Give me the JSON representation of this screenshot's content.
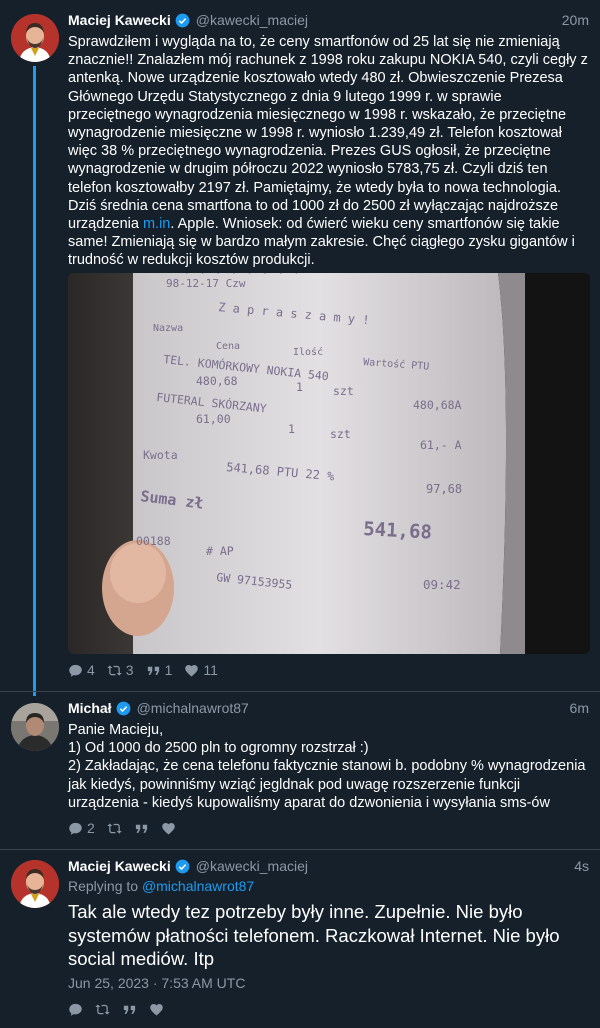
{
  "tweets": [
    {
      "name": "Maciej Kawecki",
      "handle": "@kawecki_maciej",
      "time": "20m",
      "text_before_link": "Sprawdziłem i wygląda na to, że ceny smartfonów od 25 lat się nie zmieniają znacznie!! Znalazłem mój rachunek z 1998 roku zakupu NOKIA 540, czyli cegły z antenką. Nowe urządzenie kosztowało wtedy 480 zł. Obwieszczenie Prezesa Głównego Urzędu Statystycznego z dnia 9 lutego 1999 r. w sprawie przeciętnego wynagrodzenia miesięcznego w 1998 r. wskazało, że przeciętne wynagrodzenie miesięczne w 1998 r. wyniosło 1.239,49 zł. Telefon kosztował więc 38 % przeciętnego wynagrodzenia. Prezes GUS ogłosił, że przeciętne wynagrodzenie w drugim półroczu 2022 wyniosło 5783,75 zł. Czyli dziś ten telefon kosztowałby 2197 zł. Pamiętajmy, że wtedy była to nowa technologia. Dziś średnia cena smartfona to od 1000 zł do 2500 zł wyłączając najdroższe urządzenia ",
      "link": "m.in",
      "text_after_link": ". Apple. Wniosek: od ćwierć wieku ceny smartfonów się takie same! Zmieniają się w bardzo małym zakresie. Chęć ciągłego zysku gigantów i trudność w redukcji kosztów produkcji.",
      "counts": {
        "replies": "4",
        "retweets": "3",
        "quotes": "1",
        "likes": "11"
      }
    },
    {
      "name": "Michał",
      "handle": "@michalnawrot87",
      "time": "6m",
      "lines": [
        "Panie Macieju,",
        "1) Od 1000 do 2500 pln to ogromny rozstrzał :)",
        "2) Zakładając, że cena telefonu faktycznie stanowi b. podobny % wynagrodzenia jak kiedyś, powinniśmy wziąć jegldnak pod uwagę rozszerzenie funkcji urządzenia - kiedyś kupowaliśmy aparat do dzwonienia i wysyłania sms-ów"
      ],
      "counts": {
        "replies": "2"
      }
    },
    {
      "name": "Maciej Kawecki",
      "handle": "@kawecki_maciej",
      "time": "4s",
      "replying_prefix": "Replying to ",
      "replying_to": "@michalnawrot87",
      "text": "Tak ale wtedy tez potrzeby były inne. Zupełnie. Nie było systemów płatności telefonem. Raczkował Internet. Nie było social mediów. Itp",
      "date": "Jun 25, 2023 · 7:53 AM UTC"
    }
  ],
  "receipt": {
    "header_line": "98-12-17 Czw",
    "greeting": "Z a p r a s z a m y  !",
    "columns": [
      "Nazwa",
      "Cena",
      "Ilość",
      "Wartość PTU"
    ],
    "item1_name": "TEL. KOMÓRKOWY NOKIA 540",
    "item1_price": "480,68",
    "item1_qty": "1",
    "item1_unit": "szt",
    "item1_value": "480,68A",
    "item2_name": "FUTERAL SKÓRZANY",
    "item2_price": "61,00",
    "item2_qty": "1",
    "item2_unit": "szt",
    "item2_value": "61,- A",
    "kwota_label": "Kwota",
    "kwota_value": "541,68 PTU 22 %",
    "kwota_tax": "97,68",
    "suma_label": "Suma zł",
    "suma_value": "541,68",
    "footer_code": "00188",
    "footer_ap": "# AP",
    "footer_gw": "GW 97153955",
    "footer_time": "09:42"
  }
}
